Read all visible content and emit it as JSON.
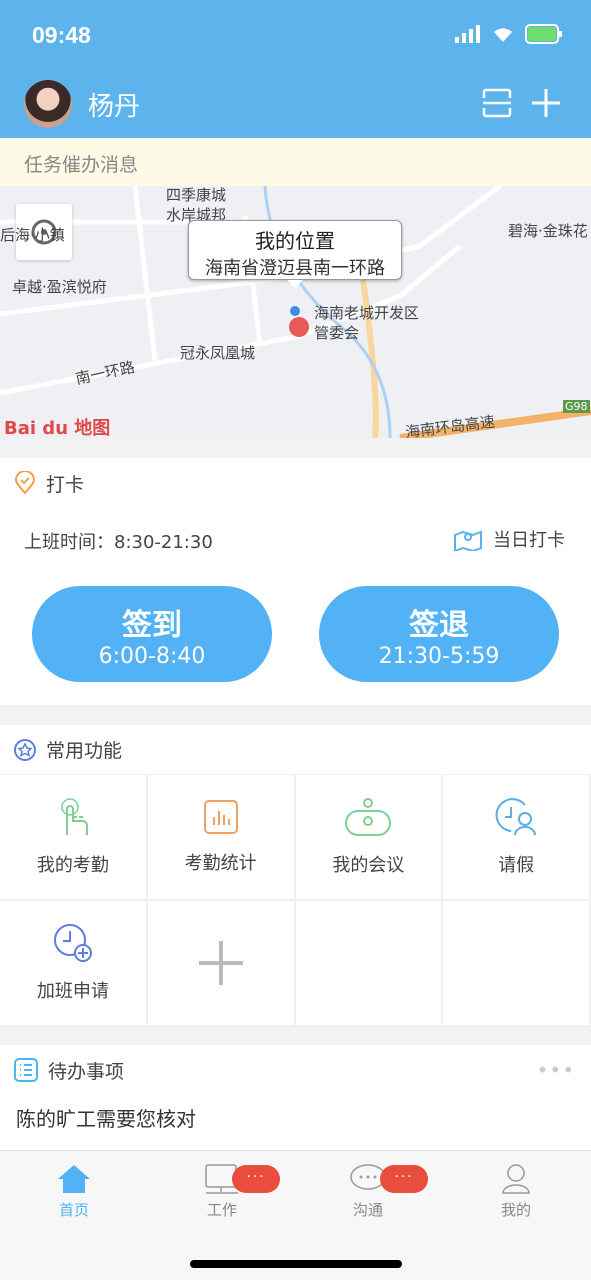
{
  "status_bar": {
    "time": "09:48"
  },
  "header": {
    "user_name": "杨丹",
    "scan_icon": "scan-icon",
    "add_icon": "plus-icon"
  },
  "notice": {
    "text": "任务催办消息"
  },
  "map": {
    "bubble_title": "我的位置",
    "bubble_address": "海南省澄迈县南一环路",
    "labels": [
      "四季康城",
      "水岸城邦",
      "后海·小镇",
      "卓越·盈滨悦府",
      "冠永凤凰城",
      "南一环路",
      "海南老城开发区",
      "管委会",
      "碧海·金珠花",
      "海南环岛高速",
      "G98"
    ],
    "logo": "Bai du 地图"
  },
  "checkin": {
    "title": "打卡",
    "work_time": "上班时间：8:30-21:30",
    "daily_link": "当日打卡",
    "sign_in": {
      "label": "签到",
      "time": "6:00-8:40"
    },
    "sign_out": {
      "label": "签退",
      "time": "21:30-5:59"
    }
  },
  "functions": {
    "title": "常用功能",
    "items": [
      {
        "label": "我的考勤",
        "icon": "hand-tap-icon",
        "color": "#7fcf93"
      },
      {
        "label": "考勤统计",
        "icon": "bar-chart-icon",
        "color": "#f0a060"
      },
      {
        "label": "我的会议",
        "icon": "meeting-icon",
        "color": "#7fcf93"
      },
      {
        "label": "请假",
        "icon": "clock-person-icon",
        "color": "#5aaee8"
      },
      {
        "label": "加班申请",
        "icon": "clock-plus-icon",
        "color": "#5a7fe0"
      }
    ]
  },
  "todo": {
    "title": "待办事项",
    "items": [
      "陈的旷工需要您核对"
    ]
  },
  "tabs": [
    {
      "label": "首页",
      "active": true
    },
    {
      "label": "工作",
      "badge": "···"
    },
    {
      "label": "沟通",
      "badge": "···"
    },
    {
      "label": "我的"
    }
  ],
  "colors": {
    "primary": "#5db4ec",
    "button": "#53b2f5",
    "badge": "#e84d3d"
  }
}
